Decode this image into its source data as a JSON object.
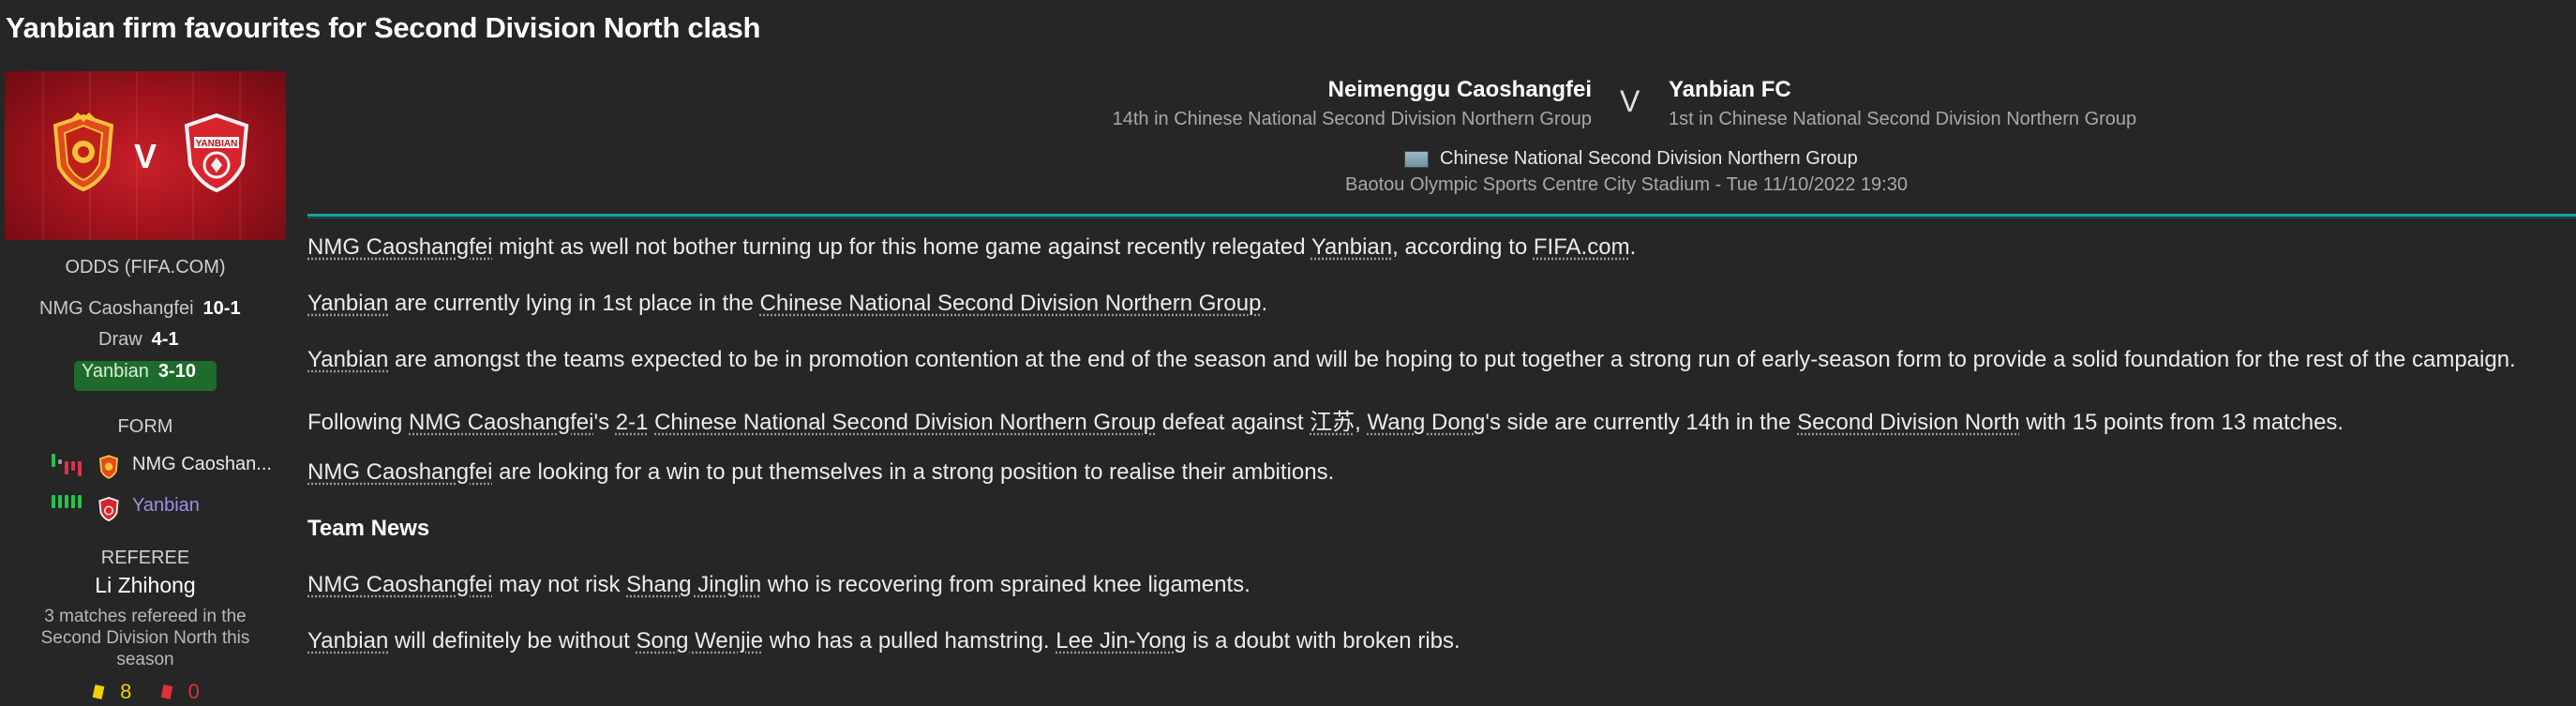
{
  "title": "Yanbian firm favourites for Second Division North clash",
  "banner": {
    "vs": "V",
    "home_crest": "home-club-crest",
    "away_crest": "yanbian-crest",
    "away_crest_text": "YANBIAN"
  },
  "odds": {
    "label": "ODDS (FIFA.COM)",
    "rows": [
      {
        "team": "NMG Caoshangfei",
        "value": "10-1"
      },
      {
        "team": "Draw",
        "value": "4-1"
      },
      {
        "team": "Yanbian",
        "value": "3-10"
      }
    ],
    "highlight_color": "#1f6b2c"
  },
  "form": {
    "label": "FORM",
    "rows": [
      {
        "team": "NMG Caoshan...",
        "results": [
          "W",
          "D",
          "L",
          "L",
          "L"
        ]
      },
      {
        "team": "Yanbian",
        "results": [
          "W",
          "W",
          "W",
          "W",
          "W"
        ]
      }
    ],
    "colors": {
      "W": "#27c24c",
      "D": "#9a9a9a",
      "L": "#d8364a"
    }
  },
  "referee": {
    "label": "REFEREE",
    "name": "Li Zhihong",
    "note": "3 matches refereed in the Second Division North this season",
    "yellow": "8",
    "red": "0"
  },
  "match": {
    "home": {
      "name": "Neimenggu Caoshangfei",
      "position": "14th in Chinese National Second Division Northern Group"
    },
    "away": {
      "name": "Yanbian FC",
      "position": "1st in Chinese National Second Division Northern Group"
    },
    "vs": "V",
    "competition": "Chinese National Second Division Northern Group",
    "venue": "Baotou Olympic Sports Centre City Stadium - Tue 11/10/2022 19:30",
    "accent": "#1aa3a3"
  },
  "article": {
    "p1": {
      "a": "NMG Caoshangfei",
      "b": " might as well not bother turning up for this home game against recently relegated ",
      "c": "Yanbian",
      "d": ", according to ",
      "e": "FIFA.com",
      "f": "."
    },
    "p2": {
      "a": "Yanbian",
      "b": " are currently lying in 1st place in the ",
      "c": "Chinese National Second Division Northern Group",
      "d": "."
    },
    "p3": {
      "a": "Yanbian",
      "b": " are amongst the teams expected to be in promotion contention at the end of the season and will be hoping to put together a strong run of early-season form to provide a solid foundation for the rest of the campaign."
    },
    "p4": {
      "a": "Following ",
      "b": "NMG Caoshangfei",
      "c": "'s ",
      "d": "2-1",
      "e": " ",
      "f": "Chinese National Second Division Northern Group",
      "g": " defeat against ",
      "h": "江苏",
      "i": ", ",
      "j": "Wang Dong",
      "k": "'s side are currently 14th in the ",
      "l": "Second Division North",
      "m": " with 15 points from 13 matches."
    },
    "p5": {
      "a": "NMG Caoshangfei",
      "b": " are looking for a win to put themselves in a strong position to realise their ambitions."
    },
    "team_news_heading": "Team News",
    "p6": {
      "a": "NMG Caoshangfei",
      "b": " may not risk ",
      "c": "Shang Jinglin",
      "d": " who is recovering from sprained knee ligaments."
    },
    "p7": {
      "a": "Yanbian",
      "b": " will definitely be without ",
      "c": "Song Wenjie",
      "d": " who has a pulled hamstring. ",
      "e": "Lee Jin-Yong",
      "f": " is a doubt with broken ribs."
    }
  }
}
